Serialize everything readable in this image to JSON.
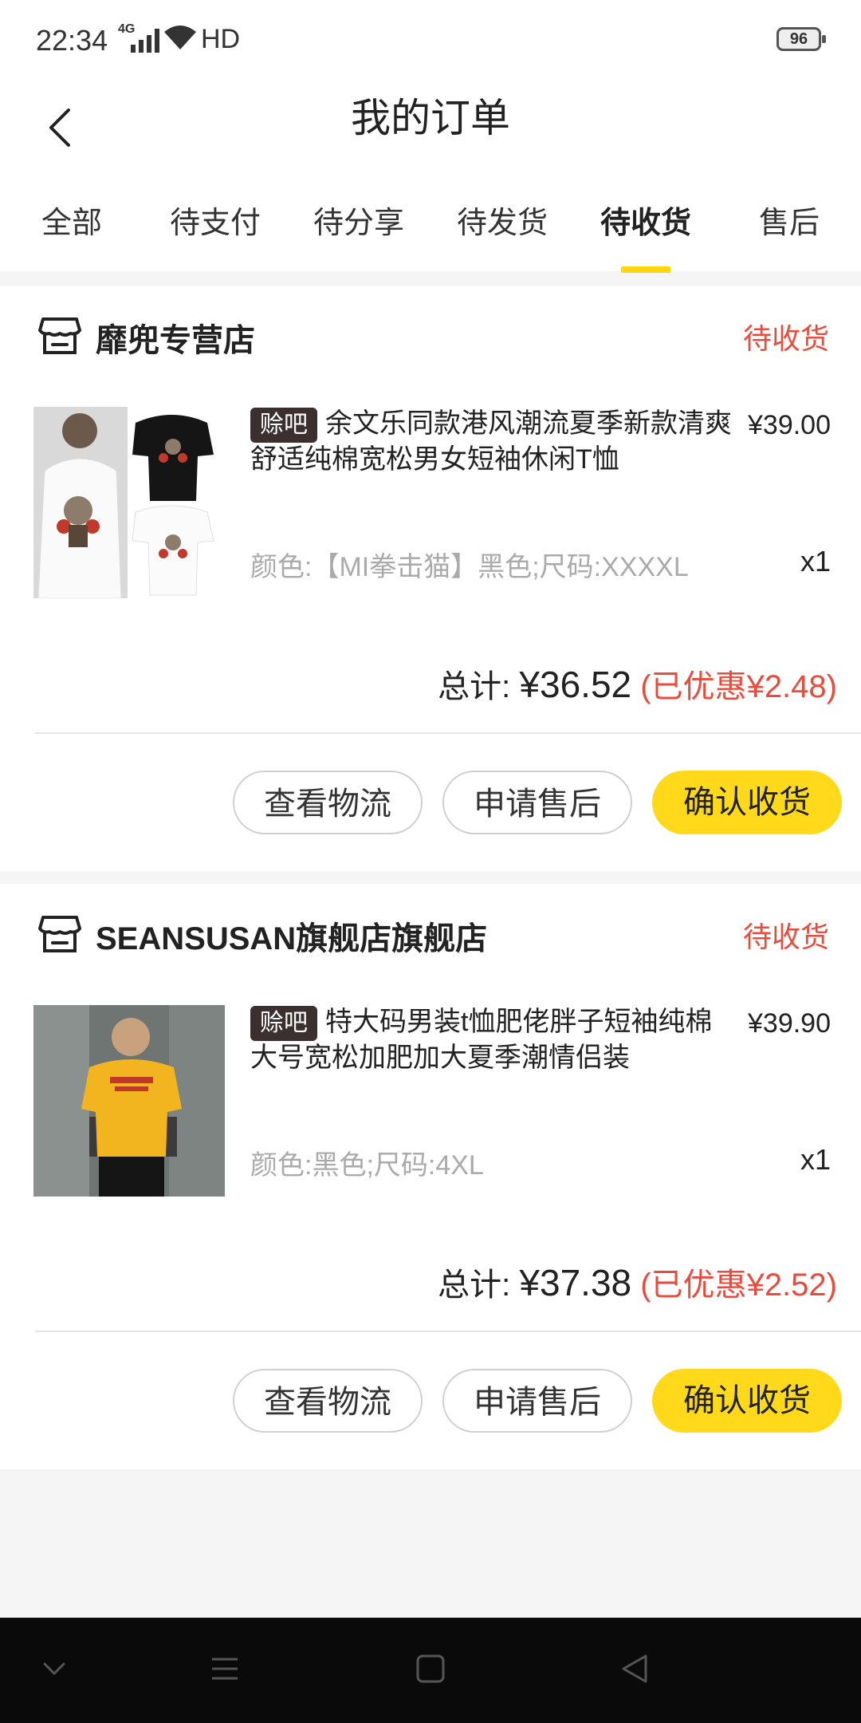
{
  "status_bar": {
    "time": "22:34",
    "network": "4G",
    "hd": "HD",
    "battery": "96"
  },
  "header": {
    "title": "我的订单"
  },
  "tabs": [
    {
      "label": "全部"
    },
    {
      "label": "待支付"
    },
    {
      "label": "待分享"
    },
    {
      "label": "待发货"
    },
    {
      "label": "待收货"
    },
    {
      "label": "售后"
    }
  ],
  "active_tab_index": 4,
  "orders": [
    {
      "shop": "靡兜专营店",
      "status": "待收货",
      "badge": "赊吧",
      "title": "余文乐同款港风潮流夏季新款清爽舒适纯棉宽松男女短袖休闲T恤",
      "price": "¥39.00",
      "spec": "颜色:【MI拳击猫】黑色;尺码:XXXXL",
      "qty": "x1",
      "total_label": "总计:",
      "total": "¥36.52",
      "discount": "(已优惠¥2.48)",
      "buttons": {
        "logistics": "查看物流",
        "after_sale": "申请售后",
        "confirm": "确认收货"
      }
    },
    {
      "shop": "SEANSUSAN旗舰店旗舰店",
      "status": "待收货",
      "badge": "赊吧",
      "title": "特大码男装t恤肥佬胖子短袖纯棉大号宽松加肥加大夏季潮情侣装",
      "price": "¥39.90",
      "spec": "颜色:黑色;尺码:4XL",
      "qty": "x1",
      "total_label": "总计:",
      "total": "¥37.38",
      "discount": "(已优惠¥2.52)",
      "buttons": {
        "logistics": "查看物流",
        "after_sale": "申请售后",
        "confirm": "确认收货"
      }
    }
  ],
  "icons": {
    "back": "back-chevron-icon",
    "shop": "store-icon",
    "nav": [
      "nav-down-icon",
      "nav-menu-icon",
      "nav-home-icon",
      "nav-back-icon"
    ]
  },
  "colors": {
    "accent": "#ffd91a",
    "status_red": "#e94b3c"
  }
}
